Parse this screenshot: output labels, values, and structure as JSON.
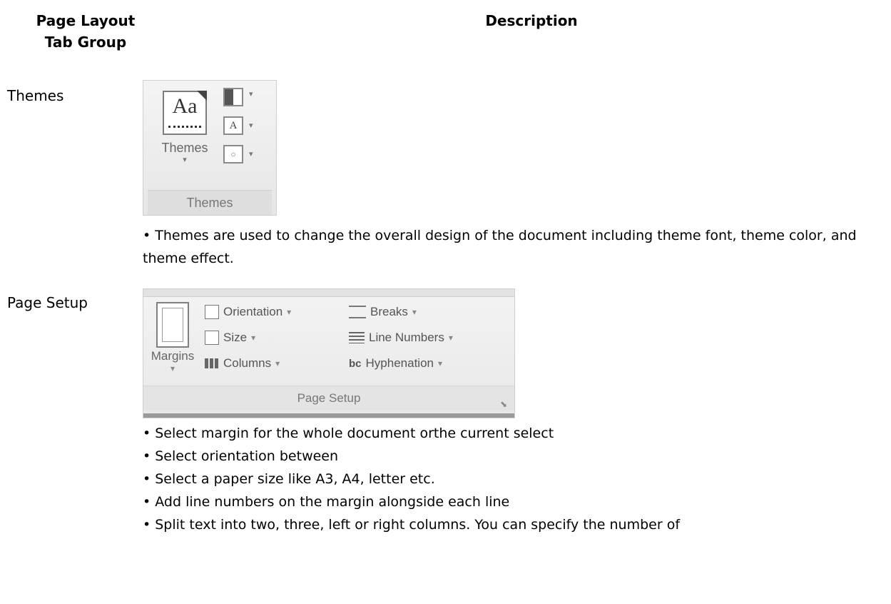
{
  "headers": {
    "left": "Page Layout\nTab Group",
    "left_line1": "Page Layout",
    "left_line2": "Tab Group",
    "right": "Description"
  },
  "rows": [
    {
      "label": "Themes",
      "ribbon": {
        "big_button_label": "Themes",
        "group_title": "Themes",
        "small_icons": [
          "theme-colors-icon",
          "theme-fonts-icon",
          "theme-effects-icon"
        ]
      },
      "description": "• Themes are used to change the overall design of the document including theme font, theme color, and theme effect."
    },
    {
      "label": "Page Setup",
      "ribbon": {
        "big_button_label": "Margins",
        "items": {
          "orientation": "Orientation",
          "size": "Size",
          "columns": "Columns",
          "breaks": "Breaks",
          "line_numbers": "Line Numbers",
          "hyphenation": "Hyphenation"
        },
        "group_title": "Page Setup",
        "caret": "▾",
        "launcher": "⬊"
      },
      "bullets": [
        "• Select margin for the whole document orthe current select",
        "• Select orientation between",
        "• Select a paper size like A3, A4, letter etc.",
        "• Add line numbers on the margin alongside each line",
        "• Split text into two, three, left or right columns. You can specify the number of"
      ]
    }
  ],
  "colors": {
    "ribbon_bg": "#ededed",
    "ribbon_border": "#cfcfcf",
    "ribbon_text": "#666666"
  }
}
